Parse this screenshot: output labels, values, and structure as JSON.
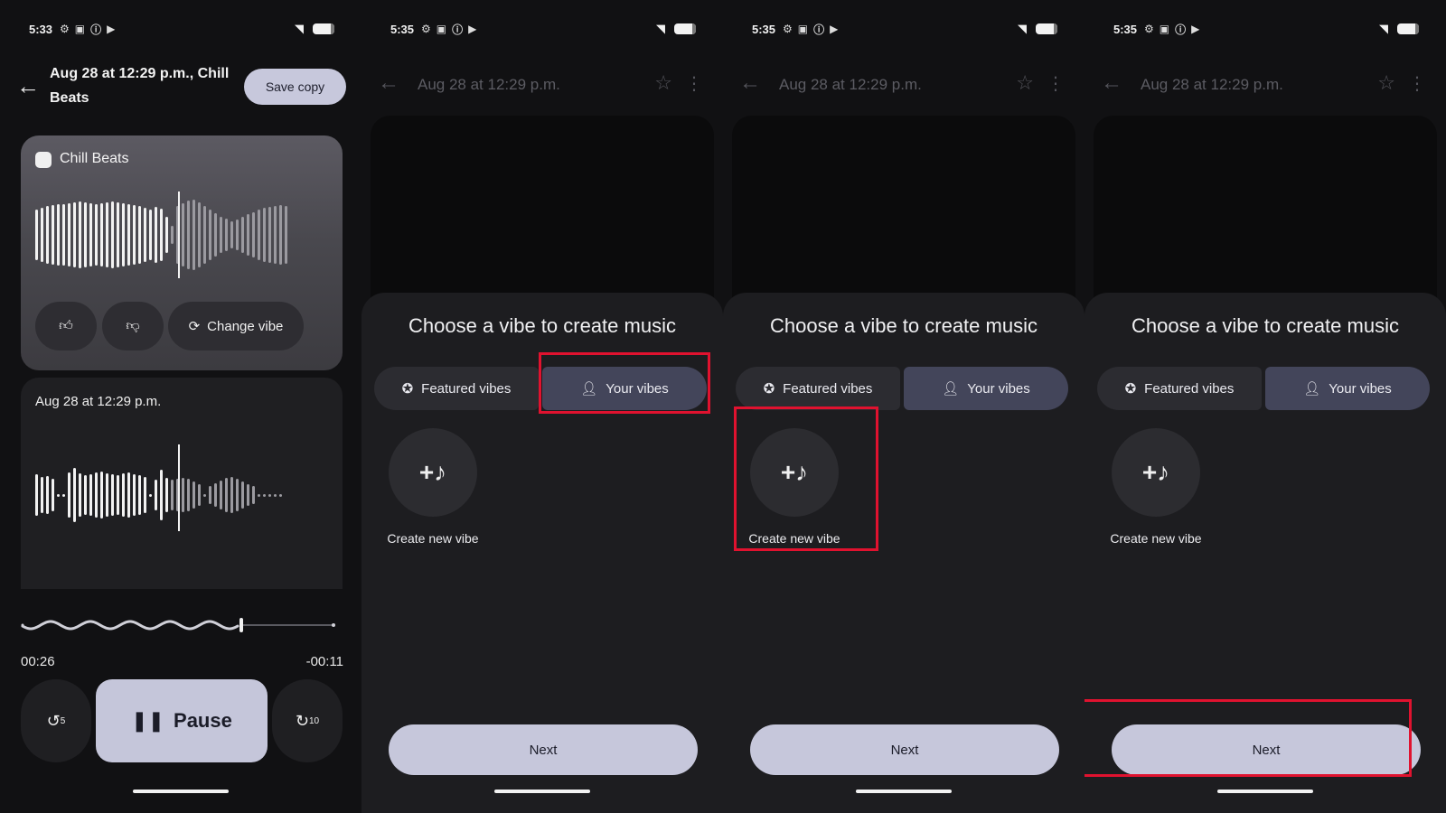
{
  "colors": {
    "highlight": "#e0122f",
    "button": "#c6c7db",
    "selected_segment": "#43455a"
  },
  "screen1": {
    "status_time": "5:33",
    "title": "Aug 28 at 12:29 p.m., Chill Beats",
    "save_copy": "Save copy",
    "card1_name": "Chill Beats",
    "change_vibe": "Change vibe",
    "card2_name": "Aug 28 at 12:29 p.m.",
    "elapsed": "00:26",
    "remaining": "-00:11",
    "playback_progress": 0.7,
    "pause": "Pause",
    "rewind_label": "5",
    "forward_label": "10"
  },
  "vibe_screens": [
    {
      "status_time": "5:35",
      "title": "Aug 28 at 12:29 p.m.",
      "sheet_title": "Choose a vibe to create music",
      "featured": "Featured vibes",
      "yours": "Your vibes",
      "create": "Create new vibe",
      "next": "Next",
      "highlight": "your-vibes"
    },
    {
      "status_time": "5:35",
      "title": "Aug 28 at 12:29 p.m.",
      "sheet_title": "Choose a vibe to create music",
      "featured": "Featured vibes",
      "yours": "Your vibes",
      "create": "Create new vibe",
      "next": "Next",
      "highlight": "create-new-vibe"
    },
    {
      "status_time": "5:35",
      "title": "Aug 28 at 12:29 p.m.",
      "sheet_title": "Choose a vibe to create music",
      "featured": "Featured vibes",
      "yours": "Your vibes",
      "create": "Create new vibe",
      "next": "Next",
      "highlight": "next"
    }
  ]
}
